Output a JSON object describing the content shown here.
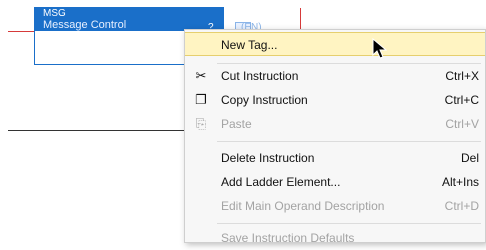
{
  "ladder": {
    "block_title": "MSG",
    "block_subtitle": "Message Control",
    "block_marker": "?",
    "output_label": "(EN)"
  },
  "context_menu": {
    "items": [
      {
        "label": "New Tag...",
        "shortcut": "",
        "icon": "",
        "state": "highlighted"
      },
      {
        "label": "Cut Instruction",
        "shortcut": "Ctrl+X",
        "icon": "scissors-icon",
        "state": "enabled"
      },
      {
        "label": "Copy Instruction",
        "shortcut": "Ctrl+C",
        "icon": "copy-icon",
        "state": "enabled"
      },
      {
        "label": "Paste",
        "shortcut": "Ctrl+V",
        "icon": "paste-icon",
        "state": "disabled"
      },
      {
        "label": "Delete Instruction",
        "shortcut": "Del",
        "icon": "",
        "state": "enabled"
      },
      {
        "label": "Add Ladder Element...",
        "shortcut": "Alt+Ins",
        "icon": "",
        "state": "enabled"
      },
      {
        "label": "Edit Main Operand Description",
        "shortcut": "Ctrl+D",
        "icon": "",
        "state": "disabled"
      },
      {
        "label": "Save Instruction Defaults",
        "shortcut": "",
        "icon": "",
        "state": "disabled"
      }
    ]
  },
  "colors": {
    "instruction_blue": "#1a6fc9",
    "highlight": "#fff4c2",
    "rung_red": "#d63a3a"
  }
}
